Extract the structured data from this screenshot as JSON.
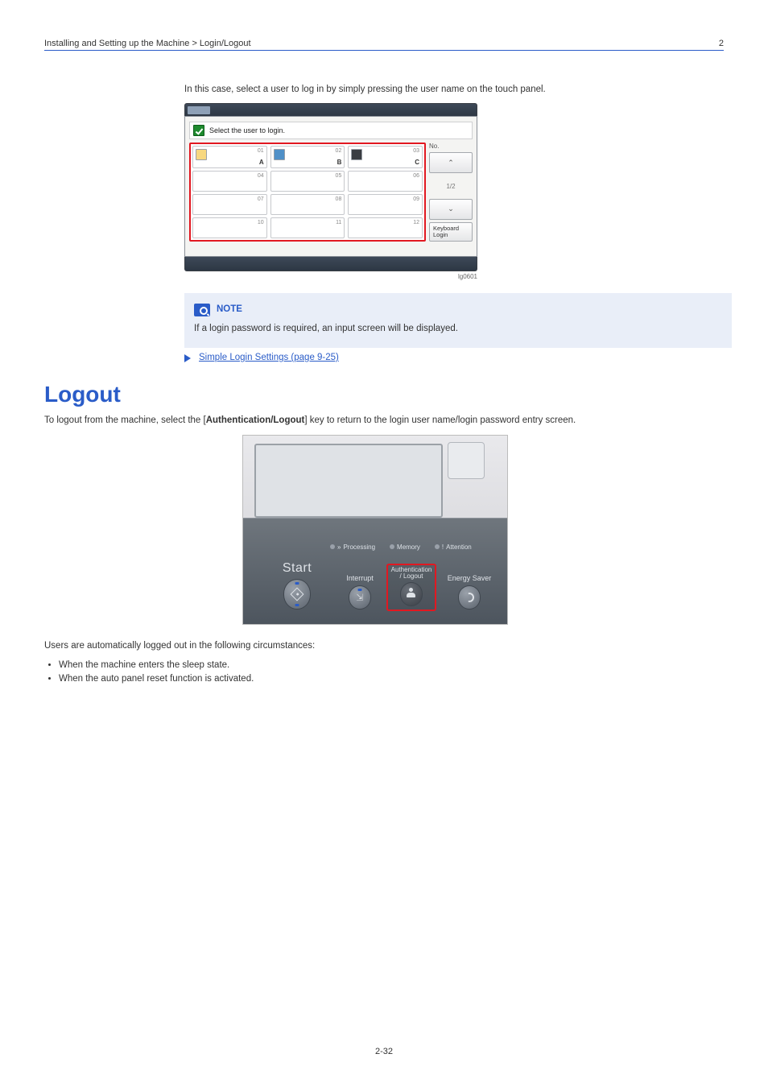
{
  "header": {
    "left": "Installing and Setting up the Machine > Login/Logout",
    "right_num": "2",
    "right_lbl": ""
  },
  "lead": "In this case, select a user to log in by simply pressing the user name on the touch panel.",
  "login": {
    "msg": "Select the user to login.",
    "no_label": "No.",
    "page": "1/2",
    "kbd": "Keyboard Login",
    "rows": [
      [
        {
          "num": "01",
          "lbl": "A",
          "av": "y"
        },
        {
          "num": "02",
          "lbl": "B",
          "av": "b"
        },
        {
          "num": "03",
          "lbl": "C",
          "av": "d"
        }
      ],
      [
        {
          "num": "04",
          "lbl": ""
        },
        {
          "num": "05",
          "lbl": ""
        },
        {
          "num": "06",
          "lbl": ""
        }
      ],
      [
        {
          "num": "07",
          "lbl": ""
        },
        {
          "num": "08",
          "lbl": ""
        },
        {
          "num": "09",
          "lbl": ""
        }
      ],
      [
        {
          "num": "10",
          "lbl": ""
        },
        {
          "num": "11",
          "lbl": ""
        },
        {
          "num": "12",
          "lbl": ""
        }
      ]
    ],
    "tag": "lg0601"
  },
  "note": {
    "heading": "NOTE",
    "body": "If a login password is required, an input screen will be displayed.",
    "xref": "Simple Login Settings (page 9-25)"
  },
  "logout": {
    "heading": "Logout",
    "body1_a": "To logout from the machine, select the [",
    "body1_b": "Authentication/Logout",
    "body1_c": "] key to return to the login user name/login password entry screen.",
    "body2": "Users are automatically logged out in the following circumstances:",
    "bullets": [
      "When the machine enters the sleep state.",
      "When the auto panel reset function is activated."
    ],
    "panel": {
      "start": "Start",
      "interrupt": "Interrupt",
      "auth": "Authentication / Logout",
      "saver": "Energy Saver",
      "status": {
        "processing": "Processing",
        "memory": "Memory",
        "attention": "Attention"
      }
    }
  },
  "page_num": "2-32"
}
